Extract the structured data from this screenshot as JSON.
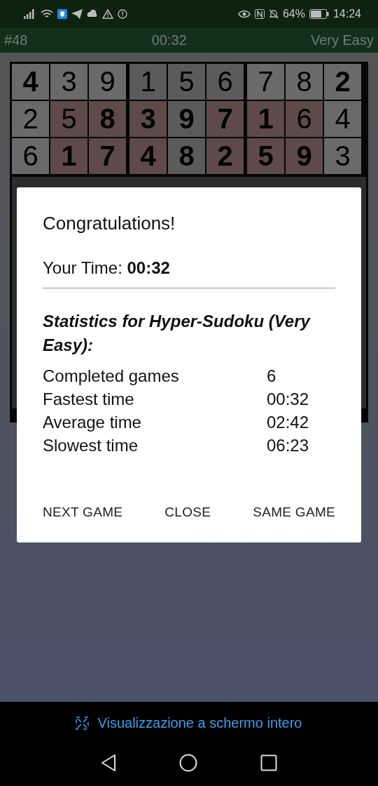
{
  "status_bar": {
    "battery": "64%",
    "time": "14:24"
  },
  "game_header": {
    "number": "#48",
    "timer": "00:32",
    "difficulty": "Very Easy"
  },
  "grid": {
    "rows": [
      [
        {
          "digit": "4",
          "given": true,
          "highlighted": false
        },
        {
          "digit": "3",
          "given": false,
          "highlighted": false
        },
        {
          "digit": "9",
          "given": false,
          "highlighted": false
        },
        {
          "digit": "1",
          "given": false,
          "highlighted": false
        },
        {
          "digit": "5",
          "given": false,
          "highlighted": false
        },
        {
          "digit": "6",
          "given": false,
          "highlighted": false
        },
        {
          "digit": "7",
          "given": false,
          "highlighted": false
        },
        {
          "digit": "8",
          "given": false,
          "highlighted": false
        },
        {
          "digit": "2",
          "given": true,
          "highlighted": false
        }
      ],
      [
        {
          "digit": "2",
          "given": false,
          "highlighted": false
        },
        {
          "digit": "5",
          "given": false,
          "highlighted": true
        },
        {
          "digit": "8",
          "given": true,
          "highlighted": true
        },
        {
          "digit": "3",
          "given": true,
          "highlighted": true
        },
        {
          "digit": "9",
          "given": true,
          "highlighted": false
        },
        {
          "digit": "7",
          "given": true,
          "highlighted": true
        },
        {
          "digit": "1",
          "given": true,
          "highlighted": true
        },
        {
          "digit": "6",
          "given": false,
          "highlighted": true
        },
        {
          "digit": "4",
          "given": false,
          "highlighted": false
        }
      ],
      [
        {
          "digit": "6",
          "given": false,
          "highlighted": false
        },
        {
          "digit": "1",
          "given": true,
          "highlighted": true
        },
        {
          "digit": "7",
          "given": true,
          "highlighted": true
        },
        {
          "digit": "4",
          "given": true,
          "highlighted": true
        },
        {
          "digit": "8",
          "given": true,
          "highlighted": false
        },
        {
          "digit": "2",
          "given": true,
          "highlighted": true
        },
        {
          "digit": "5",
          "given": true,
          "highlighted": true
        },
        {
          "digit": "9",
          "given": true,
          "highlighted": true
        },
        {
          "digit": "3",
          "given": false,
          "highlighted": false
        }
      ]
    ]
  },
  "dialog": {
    "title": "Congratulations!",
    "your_time": "Your Time: **00:32**",
    "stats_title": "Statistics for Hyper-Sudoku (Very Easy):",
    "stats": [
      {
        "label": "Completed games",
        "value": "6"
      },
      {
        "label": "Fastest time",
        "value": "00:32"
      },
      {
        "label": "Average time",
        "value": "02:42"
      },
      {
        "label": "Slowest time",
        "value": "06:23"
      }
    ],
    "buttons": [
      "NEXT GAME",
      "CLOSE",
      "SAME GAME"
    ]
  },
  "fullscreen_link": "Visualizzazione a schermo intero"
}
